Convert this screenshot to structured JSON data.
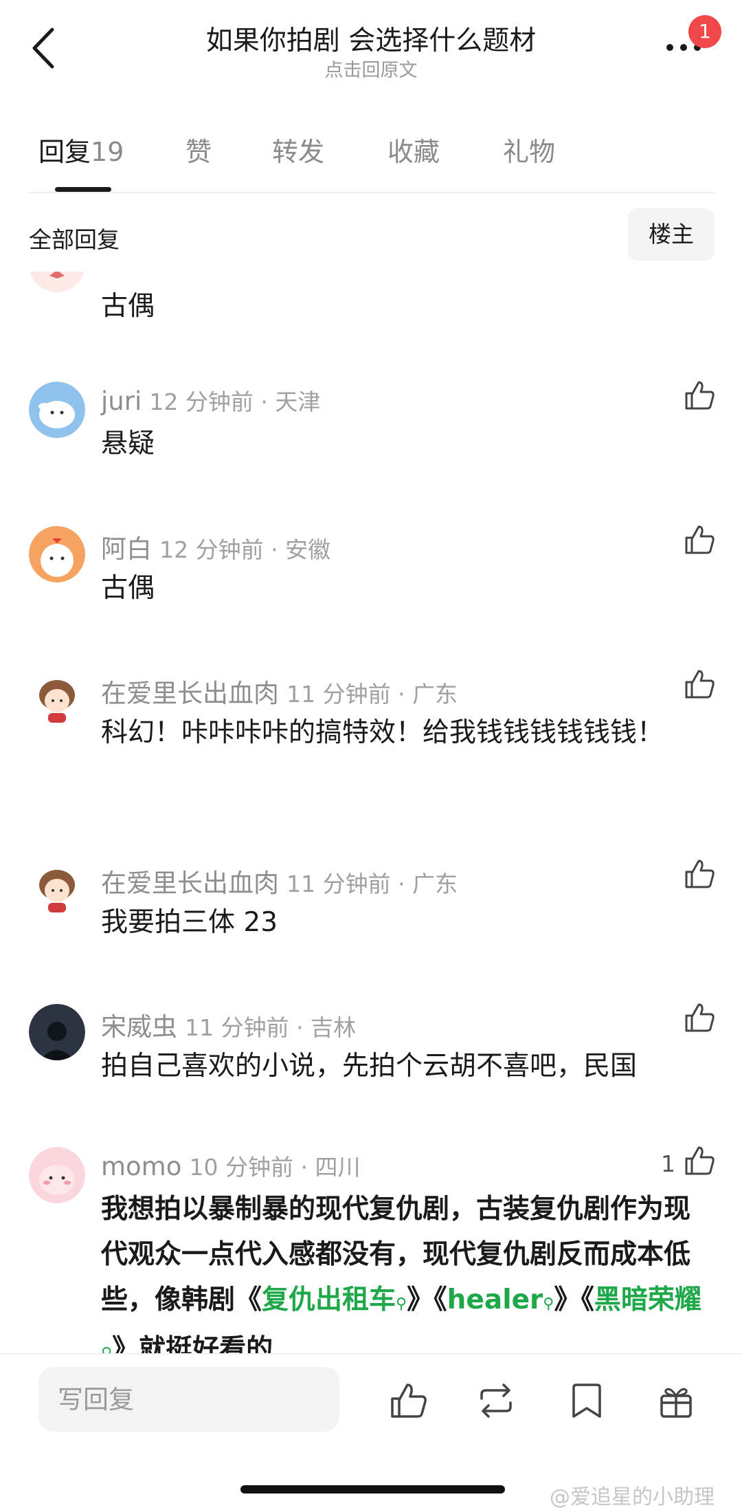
{
  "header": {
    "title": "如果你拍剧 会选择什么题材",
    "subtitle": "点击回原文",
    "notification_count": "1"
  },
  "tabs": [
    {
      "label": "回复",
      "count": "19"
    },
    {
      "label": "赞"
    },
    {
      "label": "转发"
    },
    {
      "label": "收藏"
    },
    {
      "label": "礼物"
    }
  ],
  "filter": {
    "title": "全部回复",
    "owner_button": "楼主"
  },
  "comments": [
    {
      "text": "古偶"
    },
    {
      "user": "juri",
      "time": "12 分钟前 · 天津",
      "text": "悬疑"
    },
    {
      "user": "阿白",
      "time": "12 分钟前 · 安徽",
      "text": "古偶"
    },
    {
      "user": "在爱里长出血肉",
      "time": "11 分钟前 · 广东",
      "text": "科幻！咔咔咔咔的搞特效！给我钱钱钱钱钱钱！"
    },
    {
      "user": "在爱里长出血肉",
      "time": "11 分钟前 · 广东",
      "text": "我要拍三体 23"
    },
    {
      "user": "宋威虫",
      "time": "11 分钟前 · 吉林",
      "text": "拍自己喜欢的小说，先拍个云胡不喜吧，民国"
    },
    {
      "user": "momo",
      "time": "10 分钟前 · 四川",
      "likes": "1",
      "text_parts": {
        "p1": "我想拍以暴制暴的现代复仇剧，古装复仇剧作为现代观众一点代入感都没有，现代复仇剧反而成本低些，像韩剧《",
        "tag1": "复仇出租车",
        "p2": "》《",
        "tag2": "healer",
        "p3": "》《",
        "tag3": "黑暗荣耀",
        "p4": "》就挺好看的"
      }
    }
  ],
  "bottom_bar": {
    "reply_placeholder": "写回复"
  },
  "watermark": "@爱追星的小助理",
  "colors": {
    "accent_green": "#1fa84a",
    "badge_red": "#f0474b",
    "text_primary": "#1a1a1a",
    "text_secondary": "#8e8e8e"
  }
}
